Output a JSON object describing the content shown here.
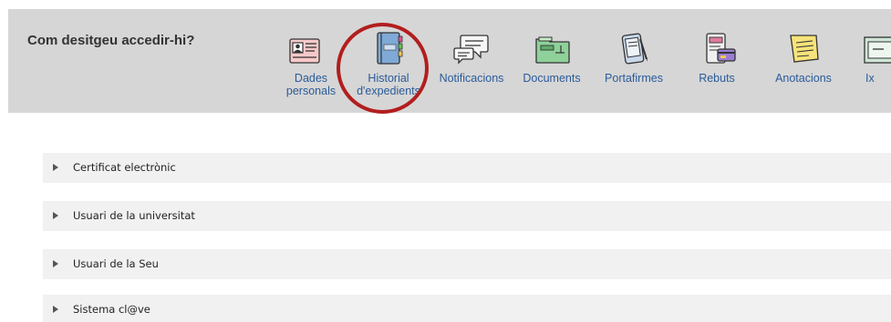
{
  "header": {
    "title": "Com desitgeu accedir-hi?",
    "items": [
      {
        "label1": "Dades",
        "label2": "personals",
        "icon": "id-card-icon"
      },
      {
        "label1": "Historial",
        "label2": "d'expedients",
        "icon": "notebook-icon"
      },
      {
        "label1": "Notificacions",
        "label2": "",
        "icon": "speech-bubbles-icon"
      },
      {
        "label1": "Documents",
        "label2": "",
        "icon": "folder-icon"
      },
      {
        "label1": "Portafirmes",
        "label2": "",
        "icon": "signature-tablet-icon"
      },
      {
        "label1": "Rebuts",
        "label2": "",
        "icon": "receipt-card-icon"
      },
      {
        "label1": "Anotacions",
        "label2": "",
        "icon": "sticky-note-icon"
      },
      {
        "label1": "Ix",
        "label2": "",
        "icon": "window-icon"
      }
    ]
  },
  "sections": [
    {
      "label": "Certificat electrònic"
    },
    {
      "label": "Usuari de la universitat"
    },
    {
      "label": "Usuari de la Seu"
    },
    {
      "label": "Sistema cl@ve"
    }
  ],
  "colors": {
    "header_bg": "#d6d6d6",
    "link": "#2a5b9a",
    "highlight": "#b21e1e",
    "accordion_bg": "#f1f1f1"
  }
}
